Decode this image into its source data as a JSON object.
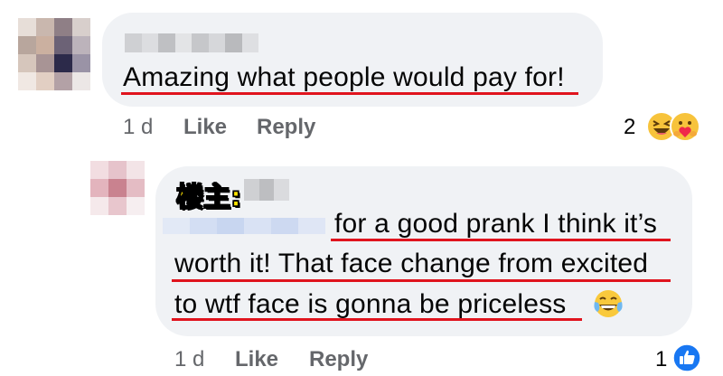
{
  "comment": {
    "text": "Amazing what people would pay for!",
    "time": "1 d",
    "like_label": "Like",
    "reply_label": "Reply",
    "reaction_count": "2",
    "reactions": [
      "haha-icon",
      "care-icon"
    ]
  },
  "reply": {
    "op_label": "楼主:",
    "lines": [
      "for a good prank I think it’s",
      "worth it! That face change from excited",
      "to wtf face is gonna be priceless"
    ],
    "time": "1 d",
    "like_label": "Like",
    "reply_label": "Reply",
    "reaction_count": "1",
    "reactions": [
      "like-icon"
    ]
  },
  "colors": {
    "bubble": "#f0f2f5",
    "meta_text": "#65676b",
    "underline": "#e0141e",
    "op_label": "#ffe400",
    "like_blue": "#1877f2"
  }
}
